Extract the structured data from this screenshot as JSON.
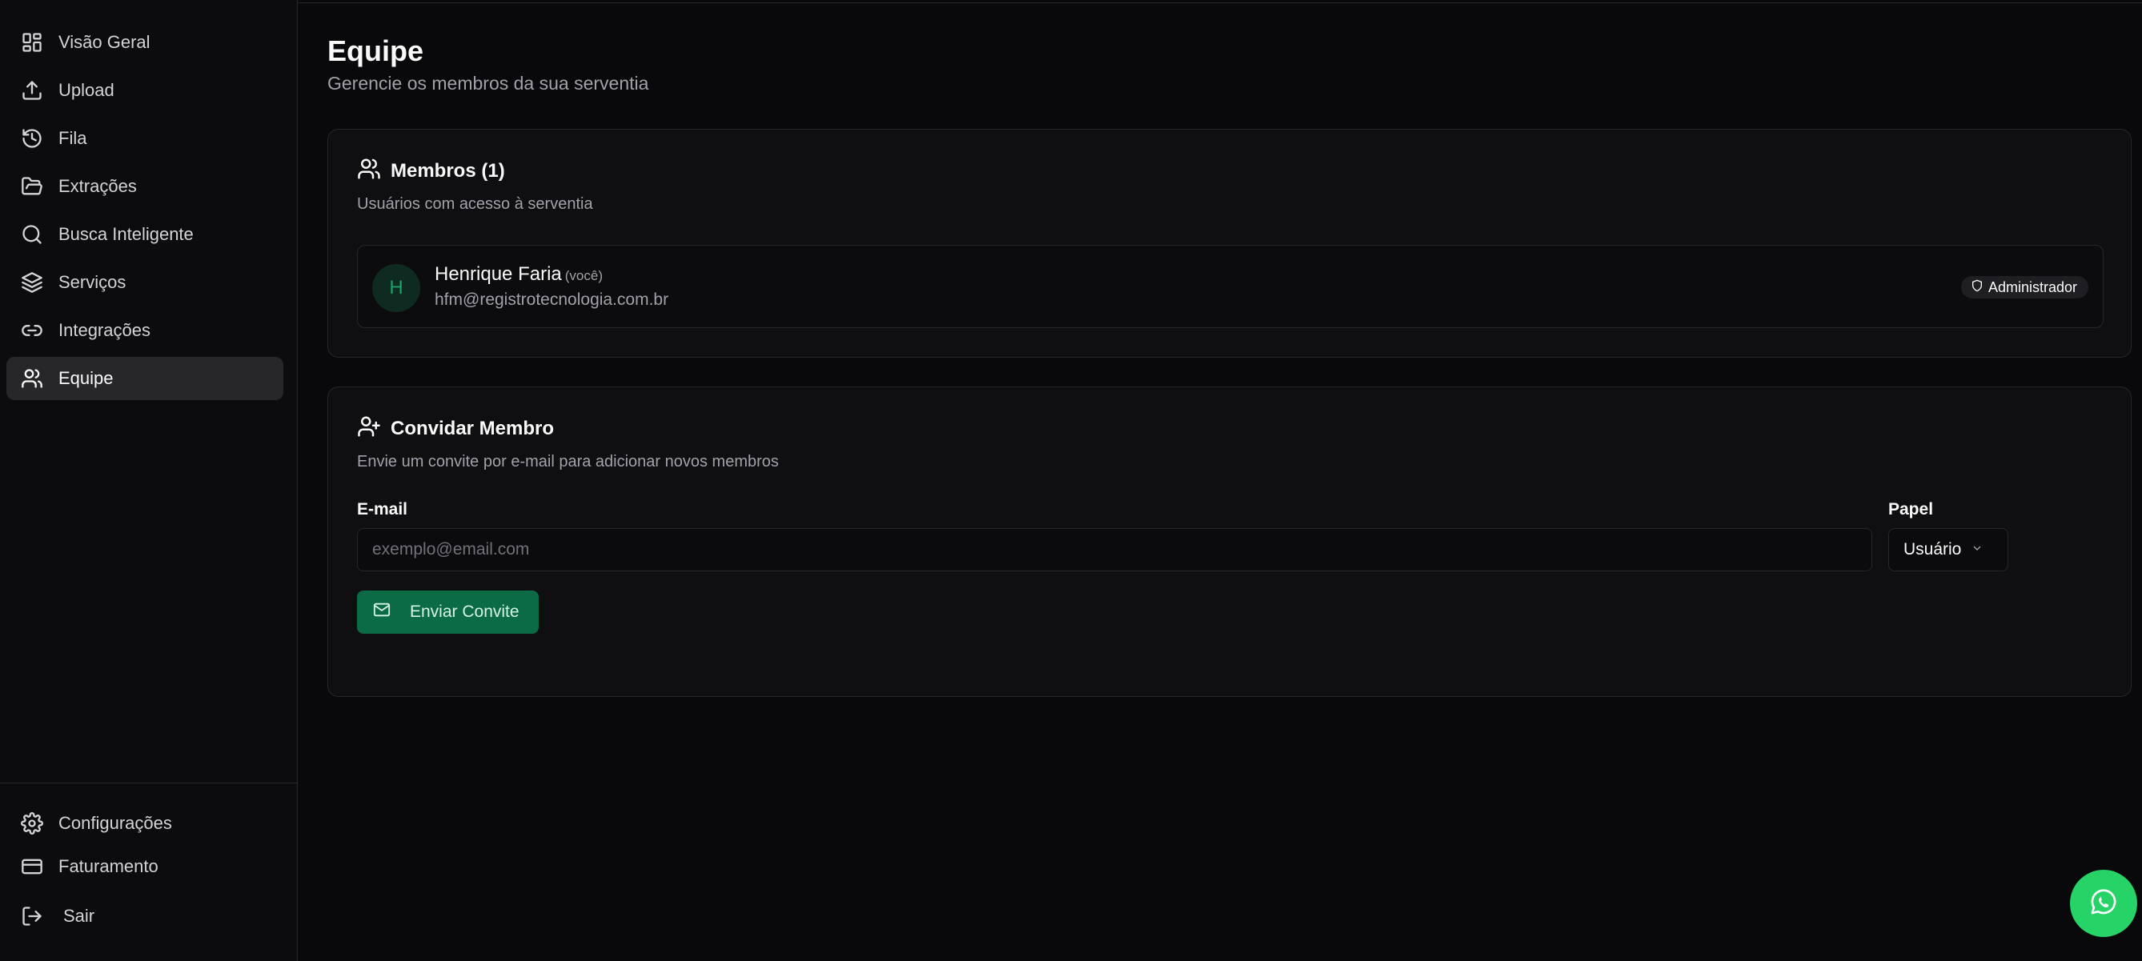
{
  "sidebar": {
    "items": [
      {
        "label": "Visão Geral",
        "icon": "dashboard-grid-icon"
      },
      {
        "label": "Upload",
        "icon": "upload-icon"
      },
      {
        "label": "Fila",
        "icon": "history-icon"
      },
      {
        "label": "Extrações",
        "icon": "folder-open-icon"
      },
      {
        "label": "Busca Inteligente",
        "icon": "search-icon"
      },
      {
        "label": "Serviços",
        "icon": "layers-icon"
      },
      {
        "label": "Integrações",
        "icon": "link-icon"
      },
      {
        "label": "Equipe",
        "icon": "users-icon",
        "active": true
      }
    ],
    "bottom_items": [
      {
        "label": "Configurações",
        "icon": "gear-icon"
      },
      {
        "label": "Faturamento",
        "icon": "credit-card-icon"
      }
    ],
    "logout_label": "Sair"
  },
  "page": {
    "title": "Equipe",
    "subtitle": "Gerencie os membros da sua serventia"
  },
  "members_card": {
    "title": "Membros (1)",
    "description": "Usuários com acesso à serventia",
    "members": [
      {
        "initial": "H",
        "name": "Henrique Faria",
        "you_tag": "(você)",
        "email": "hfm@registrotecnologia.com.br",
        "role": "Administrador"
      }
    ]
  },
  "invite_card": {
    "title": "Convidar Membro",
    "description": "Envie um convite por e-mail para adicionar novos membros",
    "email_label": "E-mail",
    "email_placeholder": "exemplo@email.com",
    "email_value": "",
    "role_label": "Papel",
    "role_value": "Usuário",
    "send_label": "Enviar Convite"
  },
  "colors": {
    "background": "#09090b",
    "sidebar": "#0c0c0e",
    "accent": "#0b6b45",
    "whatsapp": "#25d366"
  }
}
